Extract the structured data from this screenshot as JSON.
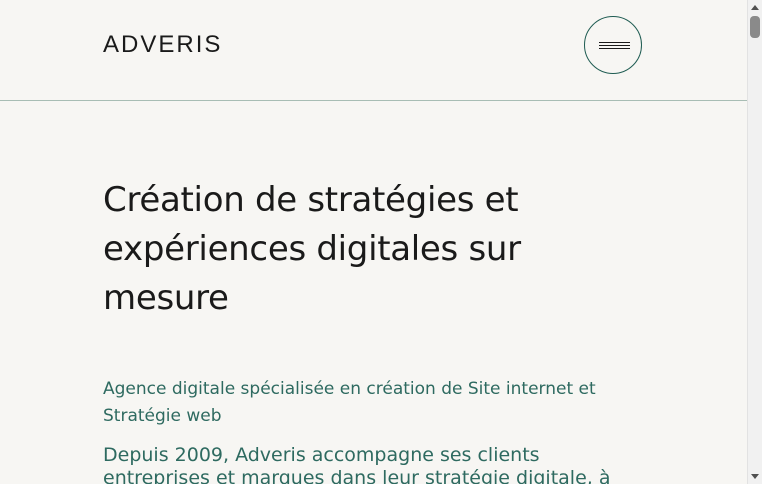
{
  "header": {
    "logo": "ADVERIS",
    "menu_icon": "hamburger-menu-icon"
  },
  "hero": {
    "title": "Création de stratégies et expériences digitales sur mesure",
    "subtitle": "Agence digitale spécialisée en création de Site internet et Stratégie web",
    "body": "Depuis 2009, Adveris accompagne ses clients entreprises et marques dans leur stratégie digitale, à"
  },
  "colors": {
    "background": "#f7f6f3",
    "accent": "#2e6a60",
    "text": "#1a1a1a",
    "divider": "#a8bdb4"
  }
}
